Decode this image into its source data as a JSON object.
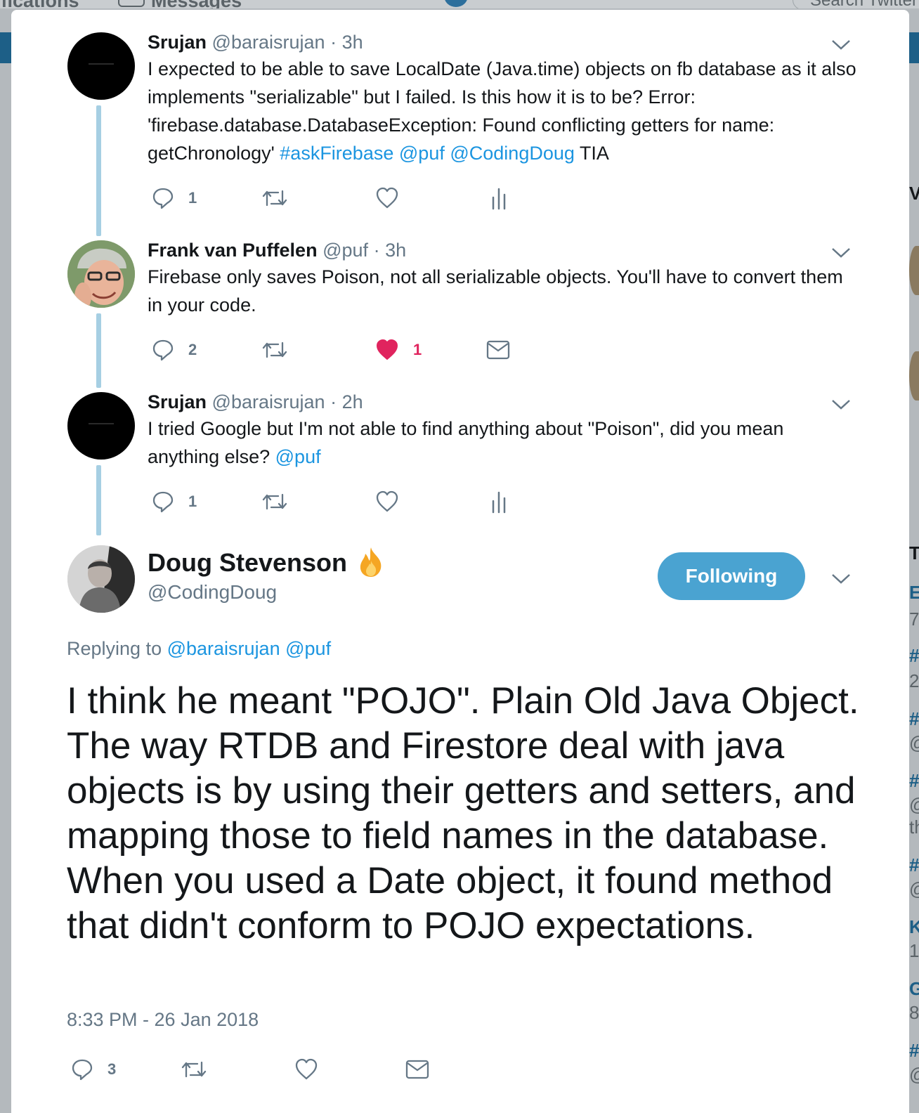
{
  "background": {
    "nav": {
      "notifications": "ifications",
      "messages": "Messages",
      "search_placeholder": "Search Twitter"
    },
    "right_column": [
      "V",
      "T",
      "E",
      "7",
      "#",
      "2",
      "#",
      "@",
      "#",
      "@",
      "th",
      "#",
      "@",
      "K",
      "1",
      "G",
      "8",
      "#",
      "@"
    ]
  },
  "thread": [
    {
      "name": "Srujan",
      "handle": "@baraisrujan",
      "dot": "·",
      "time": "3h",
      "text_parts": {
        "plain": "I expected to be able to save LocalDate (Java.time) objects on fb database as it also implements \"serializable\" but I failed. Is this how it is to be? Error: 'firebase.database.DatabaseException: Found conflicting getters for name: getChronology' ",
        "hashtag": "#askFirebase",
        "mention1": "@puf",
        "mention2": "@CodingDoug",
        "tail": " TIA"
      },
      "reply_count": "1",
      "like_count": "",
      "fourth_action": "analytics-icon"
    },
    {
      "name": "Frank van Puffelen",
      "handle": "@puf",
      "dot": "·",
      "time": "3h",
      "text": "Firebase only saves Poison, not all serializable objects. You'll have to convert them in your code.",
      "reply_count": "2",
      "like_count": "1",
      "liked": true,
      "fourth_action": "mail-icon"
    },
    {
      "name": "Srujan",
      "handle": "@baraisrujan",
      "dot": "·",
      "time": "2h",
      "text_parts": {
        "plain": "I tried Google but I'm not able to find anything about \"Poison\", did you mean anything else? ",
        "mention": "@puf"
      },
      "reply_count": "1",
      "like_count": "",
      "fourth_action": "analytics-icon"
    }
  ],
  "main_tweet": {
    "name": "Doug Stevenson",
    "emoji": "fire-icon",
    "handle": "@CodingDoug",
    "follow_label": "Following",
    "replying_label": "Replying to",
    "replying_to1": "@baraisrujan",
    "replying_to2": "@puf",
    "text": "I think he meant \"POJO\". Plain Old Java Object. The way RTDB and Firestore deal with java objects is by using their getters and setters, and mapping those to field names in the database. When you used a Date object, it found method that didn't conform to POJO expectations.",
    "timestamp": "8:33 PM - 26 Jan 2018",
    "reply_count": "3"
  },
  "colors": {
    "link": "#1b95e0",
    "follow_button": "#4aa3d1",
    "thread_line": "#a6cfe3",
    "like_active": "#e0245e",
    "secondary_text": "#657786"
  }
}
